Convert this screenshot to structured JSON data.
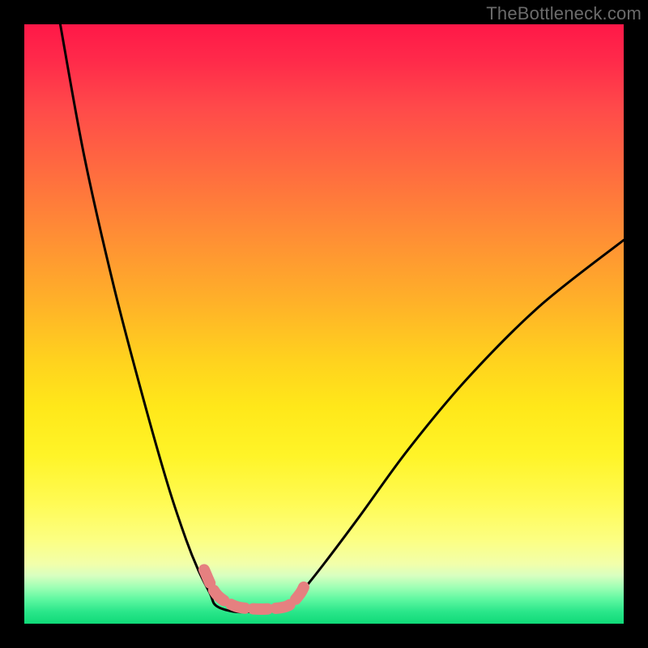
{
  "watermark": "TheBottleneck.com",
  "colors": {
    "frame": "#000000",
    "line": "#000000",
    "highlight": "#e58080",
    "gradient_top": "#ff1848",
    "gradient_mid": "#ffe81a",
    "gradient_bottom": "#10da78"
  },
  "chart_data": {
    "type": "line",
    "title": "",
    "xlabel": "",
    "ylabel": "",
    "xlim": [
      0,
      100
    ],
    "ylim": [
      0,
      100
    ],
    "grid": false,
    "legend": false,
    "annotations": [],
    "series": [
      {
        "name": "left-branch",
        "x": [
          6,
          10,
          15,
          20,
          24,
          27,
          29,
          31,
          32
        ],
        "y": [
          100,
          78,
          56,
          37,
          23,
          14,
          9,
          5,
          3
        ]
      },
      {
        "name": "valley",
        "x": [
          32,
          35,
          38,
          41,
          44,
          46
        ],
        "y": [
          3,
          2,
          2,
          2,
          3,
          5
        ]
      },
      {
        "name": "right-branch",
        "x": [
          46,
          50,
          56,
          64,
          74,
          86,
          100
        ],
        "y": [
          5,
          10,
          18,
          29,
          41,
          53,
          64
        ]
      }
    ],
    "highlight_segment": {
      "name": "bottom-highlight",
      "x": [
        30,
        32,
        35,
        38,
        41,
        44,
        46,
        47
      ],
      "y": [
        9,
        5,
        3,
        2.5,
        2.5,
        3,
        5,
        7
      ]
    }
  }
}
